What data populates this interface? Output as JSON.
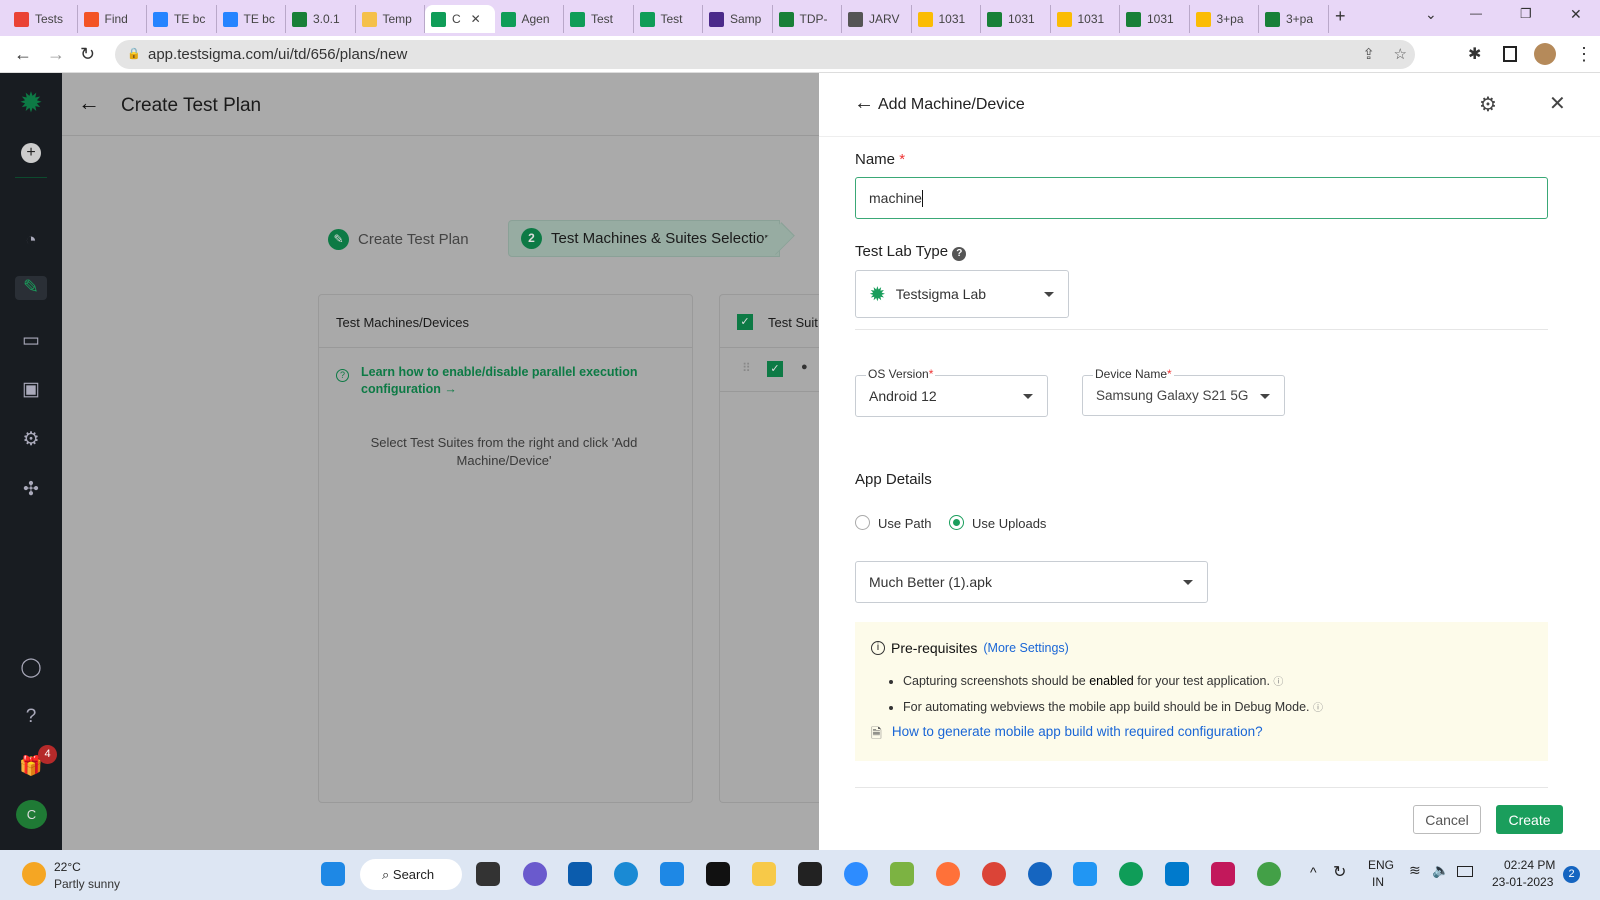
{
  "browser": {
    "tabs": [
      {
        "label": "Tests",
        "icon": "gmail-icon",
        "color": "#ea4335"
      },
      {
        "label": "Find",
        "icon": "microsoft-icon",
        "color": "#f35325"
      },
      {
        "label": "TE bc",
        "icon": "jira-icon",
        "color": "#2684ff"
      },
      {
        "label": "TE bc",
        "icon": "jira-icon",
        "color": "#2684ff"
      },
      {
        "label": "3.0.1",
        "icon": "sheets-icon",
        "color": "#188038"
      },
      {
        "label": "Temp",
        "icon": "mail-icon",
        "color": "#f5c04a"
      },
      {
        "label": "C",
        "icon": "testsigma-icon",
        "color": "#0f9d58",
        "active": true
      },
      {
        "label": "Agen",
        "icon": "testsigma-icon",
        "color": "#0f9d58"
      },
      {
        "label": "Test",
        "icon": "testsigma-icon",
        "color": "#0f9d58"
      },
      {
        "label": "Test",
        "icon": "testsigma-icon",
        "color": "#0f9d58"
      },
      {
        "label": "Samp",
        "icon": "sample-icon",
        "color": "#4b2a8a"
      },
      {
        "label": "TDP-",
        "icon": "sheets-icon",
        "color": "#188038"
      },
      {
        "label": "JARV",
        "icon": "globe-icon",
        "color": "#555"
      },
      {
        "label": "1031",
        "icon": "drive-icon",
        "color": "#fbbc04"
      },
      {
        "label": "1031",
        "icon": "sheets-icon",
        "color": "#188038"
      },
      {
        "label": "1031",
        "icon": "drive-icon",
        "color": "#fbbc04"
      },
      {
        "label": "1031",
        "icon": "sheets-icon",
        "color": "#188038"
      },
      {
        "label": "3+pa",
        "icon": "drive-icon",
        "color": "#fbbc04"
      },
      {
        "label": "3+pa",
        "icon": "sheets-icon",
        "color": "#188038"
      }
    ],
    "url": "app.testsigma.com/ui/td/656/plans/new"
  },
  "sidebar": {
    "notification_count": "4",
    "avatar_letter": "C"
  },
  "page": {
    "title": "Create Test Plan",
    "steps": [
      {
        "label": "Create Test Plan"
      },
      {
        "number": "2",
        "label": "Test Machines & Suites Selection"
      }
    ],
    "machines_card": {
      "title": "Test Machines/Devices",
      "help_link": "Learn how to enable/disable parallel execution configuration",
      "empty_text": "Select Test Suites from the right and click 'Add Machine/Device'"
    },
    "suites_card": {
      "title": "Test Suit"
    }
  },
  "panel": {
    "title": "Add Machine/Device",
    "name_label": "Name",
    "name_value": "machine",
    "lab_type_label": "Test Lab Type",
    "lab_type_value": "Testsigma Lab",
    "os_label": "OS Version",
    "os_value": "Android 12",
    "device_label": "Device Name",
    "device_value": "Samsung Galaxy S21 5G",
    "app_details_label": "App Details",
    "radio_path": "Use Path",
    "radio_uploads": "Use Uploads",
    "selected_radio": "Use Uploads",
    "upload_value": "Much Better (1).apk",
    "prereq": {
      "title": "Pre-requisites",
      "more_link": "(More Settings)",
      "item1_pre": "Capturing screenshots should be ",
      "item1_bold": "enabled",
      "item1_post": " for your test application.",
      "item2": "For automating webviews the mobile app build should be in Debug Mode.",
      "doc_link": "How to generate mobile app build with required configuration?"
    },
    "cancel": "Cancel",
    "create": "Create"
  },
  "colors": {
    "accent": "#1a9e5c",
    "link": "#1a66d6",
    "prereq_bg": "#fdfbea"
  },
  "taskbar": {
    "temp": "22°C",
    "weather": "Partly sunny",
    "search": "Search",
    "lang1": "ENG",
    "lang2": "IN",
    "time": "02:24 PM",
    "date": "23-01-2023",
    "badge": "2"
  }
}
